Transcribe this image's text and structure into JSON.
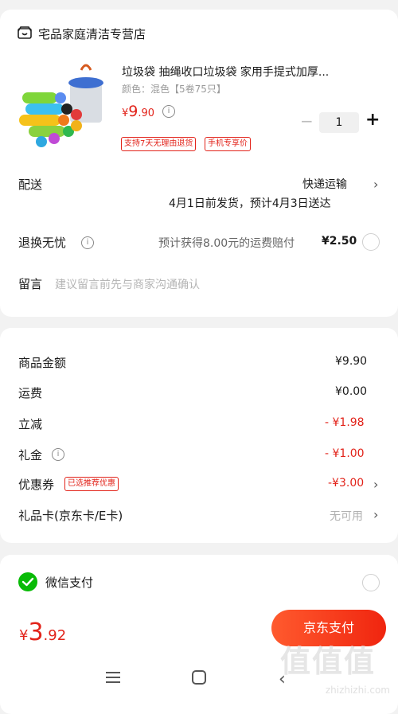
{
  "store": {
    "name": "宅品家庭清洁专营店",
    "icon": "store-icon"
  },
  "product": {
    "title": "垃圾袋 抽绳收口垃圾袋 家用手提式加厚...",
    "spec": "颜色：混色【5卷75只】",
    "price_symbol": "¥",
    "price_int": "9",
    "price_dec": ".90",
    "quantity": "1",
    "tags": [
      "支持7天无理由退货",
      "手机专享价"
    ]
  },
  "delivery": {
    "label": "配送",
    "method": "快递运输",
    "schedule": "4月1日前发货，预计4月3日送达"
  },
  "return": {
    "label": "退换无忧",
    "desc": "预计获得8.00元的运费赔付",
    "price": "¥2.50"
  },
  "message": {
    "label": "留言",
    "placeholder": "建议留言前先与商家沟通确认"
  },
  "summary": {
    "goods_label": "商品金额",
    "goods_value": "¥9.90",
    "shipping_label": "运费",
    "shipping_value": "¥0.00",
    "discount_label": "立减",
    "discount_value": "- ¥1.98",
    "gift_label": "礼金",
    "gift_value": "- ¥1.00",
    "coupon_label": "优惠券",
    "coupon_tag": "已选推荐优惠",
    "coupon_value": "-¥3.00",
    "giftcard_label": "礼品卡(京东卡/E卡)",
    "giftcard_value": "无可用"
  },
  "payment": {
    "wechat_label": "微信支付",
    "wechat_icon": "wechat-icon"
  },
  "footer": {
    "total_symbol": "¥",
    "total_int": "3",
    "total_dec": ".92",
    "pay_button": "京东支付"
  },
  "watermark": {
    "text": "值值值",
    "url": "zhizhizhi.com"
  },
  "colors": {
    "accent": "#e2231a",
    "wechat": "#09bb07",
    "button_start": "#ff5a2e",
    "button_end": "#f0250f"
  }
}
